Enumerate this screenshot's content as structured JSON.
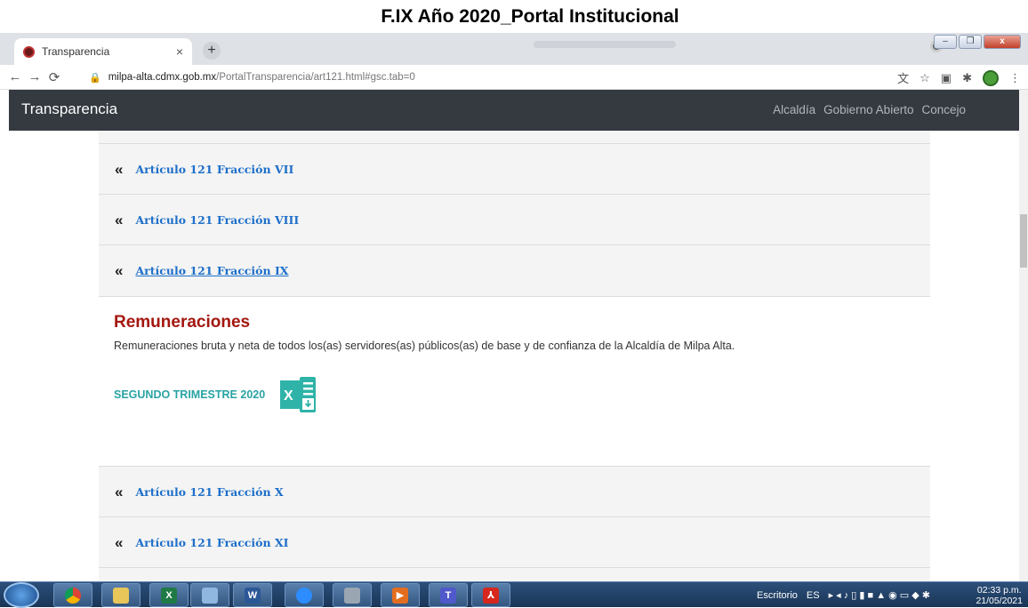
{
  "caption": "F.IX Año 2020_Portal Institucional",
  "browser": {
    "tab_title": "Transparencia",
    "tab_close": "×",
    "new_tab": "+",
    "url_host": "milpa-alta.cdmx.gob.mx",
    "url_path": "/PortalTransparencia/art121.html#gsc.tab=0"
  },
  "navbar": {
    "brand": "Transparencia",
    "links": [
      "Alcaldía",
      "Gobierno Abierto",
      "Concejo"
    ]
  },
  "articles_before": [
    {
      "label": "Artículo 121 Fracción VII",
      "underlined": false
    },
    {
      "label": "Artículo 121 Fracción VIII",
      "underlined": false
    },
    {
      "label": "Artículo 121 Fracción IX",
      "underlined": true
    }
  ],
  "detail": {
    "title": "Remuneraciones",
    "description": "Remuneraciones bruta y neta de todos los(as) servidores(as) públicos(as) de base y de confianza de la Alcaldía de Milpa Alta.",
    "download_label": "SEGUNDO TRIMESTRE 2020",
    "download_icon": "excel-download-icon"
  },
  "articles_after": [
    {
      "label": "Artículo 121 Fracción X"
    },
    {
      "label": "Artículo 121 Fracción XI"
    }
  ],
  "chevron": "«",
  "taskbar": {
    "desktop_label": "Escritorio",
    "language": "ES",
    "time": "02:33 p.m.",
    "date": "21/05/2021"
  },
  "colors": {
    "navbar_bg": "#343a40",
    "link": "#1e6fc9",
    "heading": "#a3170f",
    "download": "#2aa3a3"
  }
}
